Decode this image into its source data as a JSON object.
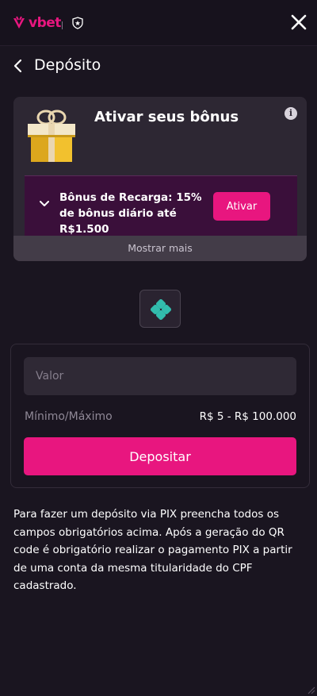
{
  "brand": {
    "logo_text": "vbet",
    "accent": "#e8167f"
  },
  "header": {
    "title": "Depósito"
  },
  "bonus": {
    "title": "Ativar seus bônus",
    "offer_text": "Bônus de Recarga: 15% de bônus diário até R$1.500",
    "activate_label": "Ativar",
    "show_more_label": "Mostrar mais"
  },
  "payment": {
    "method_icon": "pix-icon"
  },
  "form": {
    "amount_placeholder": "Valor",
    "minmax_label": "Mínimo/Máximo",
    "minmax_value": "R$ 5 - R$ 100.000",
    "submit_label": "Depositar"
  },
  "notice": "Para fazer um depósito via PIX preencha todos os campos obrigatórios acima. Após a geração do QR code é obrigatório realizar o pagamento PIX a partir de uma conta da mesma titularidade do CPF cadastrado."
}
